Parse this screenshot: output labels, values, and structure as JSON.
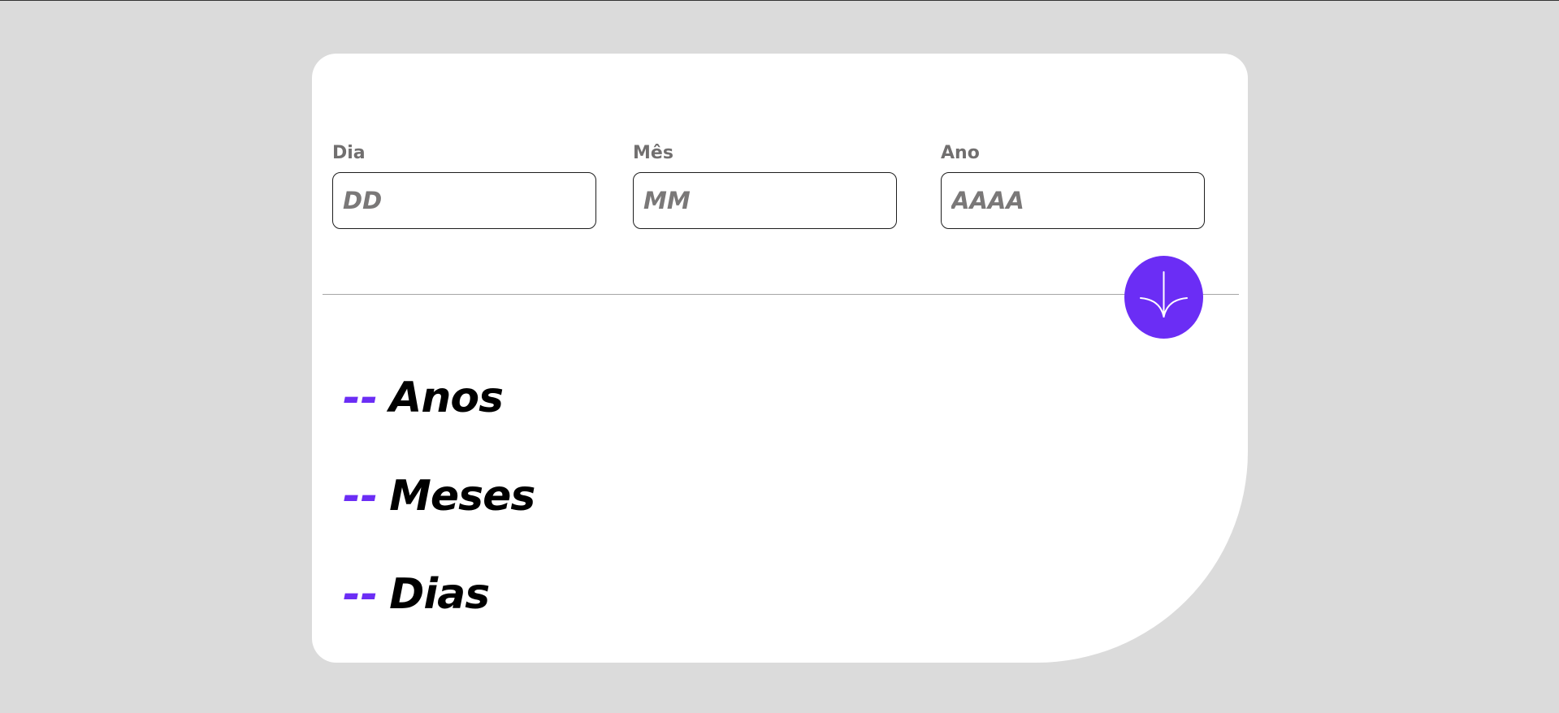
{
  "form": {
    "day": {
      "label": "Dia",
      "placeholder": "DD",
      "value": ""
    },
    "month": {
      "label": "Mês",
      "placeholder": "MM",
      "value": ""
    },
    "year": {
      "label": "Ano",
      "placeholder": "AAAA",
      "value": ""
    },
    "submit_icon": "arrow-down-icon"
  },
  "results": {
    "years": {
      "value": "--",
      "unit": "Anos"
    },
    "months": {
      "value": "--",
      "unit": "Meses"
    },
    "days": {
      "value": "--",
      "unit": "Dias"
    }
  },
  "colors": {
    "accent": "#6b2df5",
    "background": "#dbdbdb",
    "card": "#ffffff",
    "label": "#716f6f",
    "text": "#000000"
  }
}
